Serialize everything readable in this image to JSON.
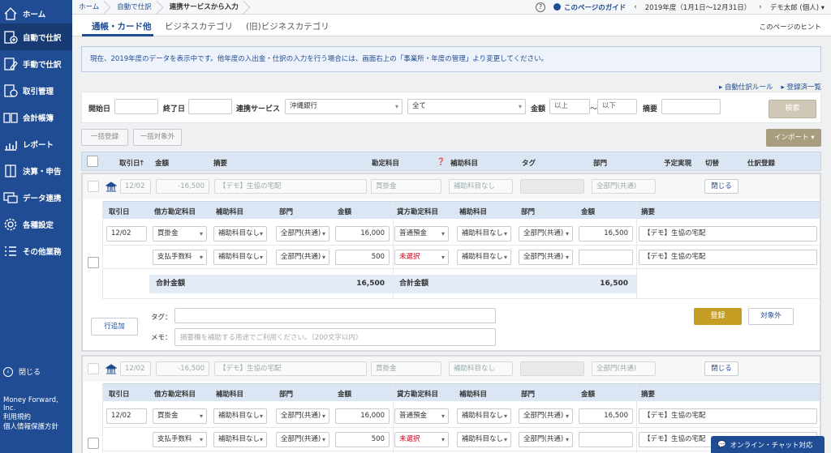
{
  "sidebar": {
    "items": [
      {
        "label": "ホーム",
        "icon": "home-icon"
      },
      {
        "label": "自動で仕訳",
        "icon": "auto-journal-icon"
      },
      {
        "label": "手動で仕訳",
        "icon": "manual-journal-icon"
      },
      {
        "label": "取引管理",
        "icon": "transaction-icon"
      },
      {
        "label": "会計帳簿",
        "icon": "ledger-icon"
      },
      {
        "label": "レポート",
        "icon": "report-icon"
      },
      {
        "label": "決算・申告",
        "icon": "settlement-icon"
      },
      {
        "label": "データ連携",
        "icon": "data-link-icon"
      },
      {
        "label": "各種設定",
        "icon": "gear-icon"
      },
      {
        "label": "その他業務",
        "icon": "list-icon"
      }
    ],
    "close": "閉じる",
    "company": "Money Forward, Inc.",
    "terms": "利用規約",
    "privacy": "個人情報保護方針"
  },
  "breadcrumb": [
    "ホーム",
    "自動で仕訳",
    "連携サービスから入力"
  ],
  "header": {
    "guide": "このページのガイド",
    "fiscal_year": "2019年度（1月1日〜12月31日）",
    "user": "デモ太郎 (個人)"
  },
  "tabs": [
    "通帳・カード他",
    "ビジネスカテゴリ",
    "(旧)ビジネスカテゴリ"
  ],
  "page_hint": "このページのヒント",
  "notice": "現在、2019年度のデータを表示中です。他年度の入出金・仕訳の入力を行う場合には、画面右上の「事業所・年度の管理」より変更してください。",
  "links": {
    "auto_rule": "自動仕訳ルール",
    "registered": "登録済一覧"
  },
  "filter": {
    "start_label": "開始日",
    "end_label": "終了日",
    "service_label": "連携サービス",
    "service_value": "沖縄銀行",
    "type_value": "全て",
    "amount_label": "金額",
    "min_placeholder": "以上",
    "range_sep": "〜",
    "max_placeholder": "以下",
    "memo_label": "摘要",
    "search": "検索"
  },
  "actions": {
    "bulk_register": "一括登録",
    "bulk_exclude": "一括対象外",
    "import": "インポート"
  },
  "list_headers": [
    "取引日",
    "金額",
    "摘要",
    "勘定科目",
    "補助科目",
    "タグ",
    "部門",
    "予定実現",
    "切替",
    "仕訳登録"
  ],
  "journal_headers": [
    "取引日",
    "借方勘定科目",
    "補助科目",
    "部門",
    "金額",
    "貸方勘定科目",
    "補助科目",
    "部門",
    "金額",
    "摘要"
  ],
  "entries": [
    {
      "summary": {
        "date": "12/02",
        "amount": "-16,500",
        "memo": "【デモ】生協の宅配",
        "account": "買掛金",
        "sub": "補助科目なし",
        "dept": "全部門(共通)",
        "close": "閉じる"
      },
      "rows": [
        {
          "date": "12/02",
          "debit": "買掛金",
          "dsub": "補助科目なし",
          "ddept": "全部門(共通)",
          "damt": "16,000",
          "credit": "普通預金",
          "csub": "補助科目なし",
          "cdept": "全部門(共通)",
          "camt": "16,500",
          "memo": "【デモ】生協の宅配"
        },
        {
          "date": "",
          "debit": "支払手数料",
          "dsub": "補助科目なし",
          "ddept": "全部門(共通)",
          "damt": "500",
          "credit": "未選択",
          "csub": "補助科目なし",
          "cdept": "全部門(共通)",
          "camt": "",
          "memo": "【デモ】生協の宅配"
        }
      ],
      "total_label": "合計金額",
      "debit_total": "16,500",
      "credit_total": "16,500",
      "add_row": "行追加",
      "tag_label": "タグ：",
      "memo_label": "メモ：",
      "memo_placeholder": "摘要欄を補助する用途でご利用ください。（200文字以内）",
      "register": "登録",
      "exclude": "対象外"
    },
    {
      "summary": {
        "date": "12/02",
        "amount": "-16,500",
        "memo": "【デモ】生協の宅配",
        "account": "買掛金",
        "sub": "補助科目なし",
        "dept": "全部門(共通)",
        "close": "閉じる"
      },
      "rows": [
        {
          "date": "12/02",
          "debit": "買掛金",
          "dsub": "補助科目なし",
          "ddept": "全部門(共通)",
          "damt": "16,000",
          "credit": "普通預金",
          "csub": "補助科目なし",
          "cdept": "全部門(共通)",
          "camt": "16,500",
          "memo": "【デモ】生協の宅配"
        },
        {
          "date": "",
          "debit": "支払手数料",
          "dsub": "補助科目なし",
          "ddept": "全部門(共通)",
          "damt": "500",
          "credit": "未選択",
          "csub": "補助科目なし",
          "cdept": "全部門(共通)",
          "camt": "",
          "memo": "【デモ】生協の宅配"
        }
      ]
    }
  ],
  "chat": "オンライン・チャット対応",
  "colors": {
    "sidebar": "#1f4c93",
    "accent": "#c59d22",
    "unselected": "#d0021b"
  }
}
